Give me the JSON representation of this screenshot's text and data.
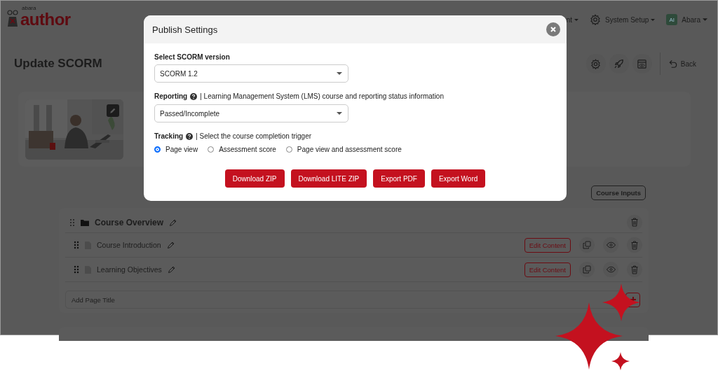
{
  "header": {
    "logo": {
      "small": "abara",
      "main": "author"
    },
    "nav": [
      {
        "kind": "menu",
        "label": "nt"
      },
      {
        "kind": "settings",
        "label": "System Setup"
      },
      {
        "kind": "user",
        "avatar": "AI",
        "label": "Abara"
      }
    ]
  },
  "page": {
    "title": "Update SCORM",
    "back": "Back"
  },
  "course_inputs": "Course Inputs",
  "outline": {
    "section": "Course Overview",
    "pages": [
      {
        "title": "Course Introduction",
        "action": "Edit Content"
      },
      {
        "title": "Learning Objectives",
        "action": "Edit Content"
      }
    ],
    "add_page": {
      "placeholder": "Add Page Title"
    }
  },
  "dialog": {
    "title": "Publish Settings",
    "version": {
      "label": "Select SCORM version",
      "value": "SCORM 1.2"
    },
    "reporting": {
      "label": "Reporting",
      "note": "| Learning Management System (LMS) course and reporting status information",
      "value": "Passed/Incomplete"
    },
    "tracking": {
      "label": "Tracking",
      "note": "| Select the course completion trigger",
      "options": [
        {
          "label": "Page view",
          "selected": true
        },
        {
          "label": "Assessment score",
          "selected": false
        },
        {
          "label": "Page view and assessment score",
          "selected": false
        }
      ]
    },
    "buttons": [
      "Download ZIP",
      "Download LITE ZIP",
      "Export PDF",
      "Export Word"
    ]
  }
}
